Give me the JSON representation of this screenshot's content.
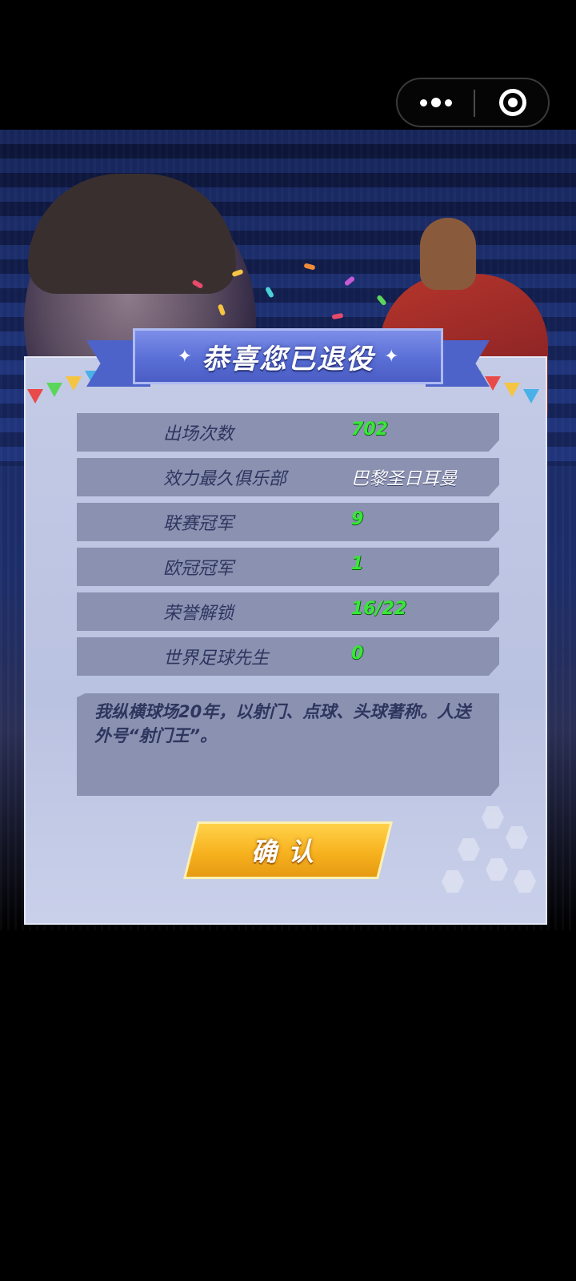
{
  "capsule": {
    "more_icon": "more-dots-icon",
    "close_icon": "target-circle-icon"
  },
  "dialog": {
    "title": "恭喜您已退役",
    "stats": [
      {
        "label": "出场次数",
        "value": "702",
        "value_color": "#39e639"
      },
      {
        "label": "效力最久俱乐部",
        "value": "巴黎圣日耳曼",
        "value_color": "#ffffff"
      },
      {
        "label": "联赛冠军",
        "value": "9",
        "value_color": "#39e639"
      },
      {
        "label": "欧冠冠军",
        "value": "1",
        "value_color": "#39e639"
      },
      {
        "label": "荣誉解锁",
        "value": "16/22",
        "value_color": "#39e639"
      },
      {
        "label": "世界足球先生",
        "value": "0",
        "value_color": "#39e639"
      }
    ],
    "description": "我纵横球场20年，以射门、点球、头球著称。人送外号“射门王”。",
    "confirm_label": "确认"
  },
  "colors": {
    "panel": "#c4cbe6",
    "ribbon": "#5a6fd6",
    "row": "#8a91b1",
    "confirm": "#f7b21f"
  }
}
